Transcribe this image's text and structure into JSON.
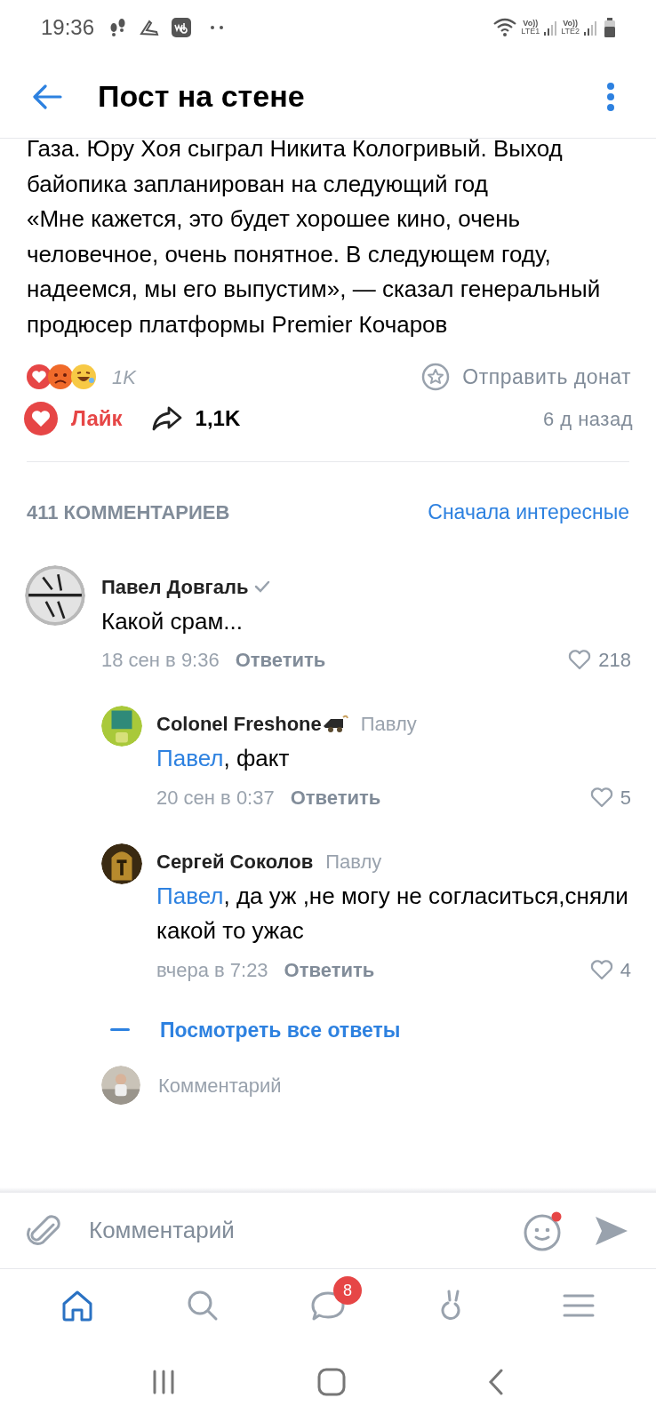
{
  "status_bar": {
    "time": "19:36",
    "sims": [
      {
        "volte": "Vo))",
        "label": "LTE1"
      },
      {
        "volte": "Vo))",
        "label": "LTE2"
      }
    ]
  },
  "header": {
    "title": "Пост на стене"
  },
  "post": {
    "paragraphs": [
      "Газа. Юру Хоя сыграл Никита Кологривый. Выход байопика запланирован на следующий год",
      "«Мне кажется, это будет хорошее кино, очень человечное, очень понятное. В следующем году, надеемся, мы его выпустим», — сказал генеральный продюсер платформы Premier Кочаров"
    ],
    "reactions_count": "1K",
    "donate": "Отправить донат",
    "like": {
      "label": "Лайк",
      "liked": true
    },
    "shares": "1,1K",
    "time": "6 д назад"
  },
  "comments_header": {
    "count": "411 КОММЕНТАРИЕВ",
    "sort": "Сначала интересные"
  },
  "comments": [
    {
      "author": "Павел Довгаль",
      "verified": true,
      "text": "Какой срам...",
      "date": "18 сен в 9:36",
      "reply": "Ответить",
      "likes": "218",
      "replies": [
        {
          "author": "Colonel Freshone",
          "emoji": true,
          "to": "Павлу",
          "mention": "Павел",
          "text": ", факт",
          "date": "20 сен в 0:37",
          "reply": "Ответить",
          "likes": "5"
        },
        {
          "author": "Сергей Соколов",
          "emoji": false,
          "to": "Павлу",
          "mention": "Павел",
          "text": ", да уж ,не могу не согласиться,сняли какой то ужас",
          "date": "вчера в 7:23",
          "reply": "Ответить",
          "likes": "4"
        }
      ],
      "show_all": "Посмотреть все ответы",
      "reply_placeholder": "Комментарий"
    }
  ],
  "composer": {
    "placeholder": "Комментарий",
    "emoji_dot": true
  },
  "nav": [
    {
      "kind": "home",
      "selected": true
    },
    {
      "kind": "search",
      "selected": false
    },
    {
      "kind": "messages",
      "selected": false,
      "badge": "8"
    },
    {
      "kind": "clips",
      "selected": false
    },
    {
      "kind": "menu",
      "selected": false
    }
  ]
}
